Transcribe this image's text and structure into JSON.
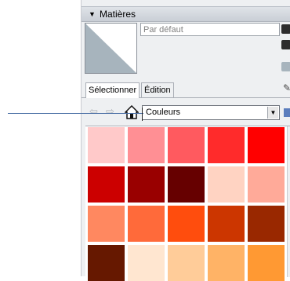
{
  "materials_panel": {
    "title": "Matières",
    "name_field_value": "Par défaut",
    "tabs": [
      {
        "label": "Sélectionner",
        "active": true
      },
      {
        "label": "Édition",
        "active": false
      }
    ],
    "collection_select": {
      "selected": "Couleurs"
    },
    "icons": {
      "collapse": "triangle-down-icon",
      "back": "left-arrow-icon",
      "forward": "right-arrow-icon",
      "home": "home-icon",
      "dropdown": "chevron-down-icon",
      "sample": "eyedropper-icon"
    },
    "preview_colors": {
      "light": "#ffffff",
      "dark": "#a7b4bd"
    },
    "swatches": [
      "#ffc9c9",
      "#ff8f94",
      "#ff5a5f",
      "#ff2b2b",
      "#ff0000",
      "#cc0000",
      "#990000",
      "#660000",
      "#ffd3c2",
      "#ffaa99",
      "#ff8860",
      "#ff6a3a",
      "#ff4d0d",
      "#cc3600",
      "#992800",
      "#661800",
      "#ffe6d0",
      "#ffcc99",
      "#ffb366",
      "#ff9933"
    ]
  }
}
